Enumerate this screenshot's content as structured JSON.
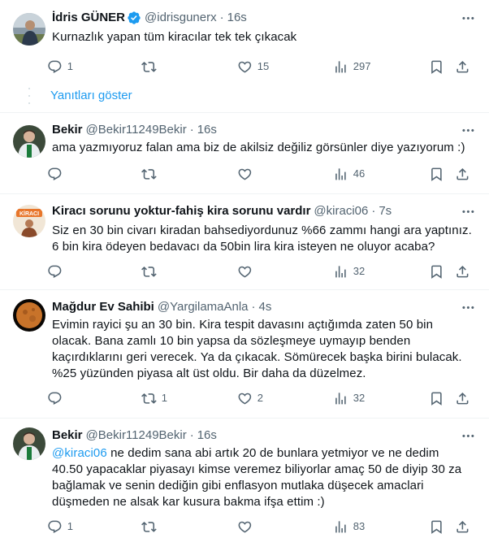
{
  "tweets": [
    {
      "name": "İdris GÜNER",
      "verified": true,
      "handle": "@idrisgunerx",
      "time": "16s",
      "text": "Kurnazlık yapan tüm kiracılar tek tek çıkacak",
      "reply_count": "1",
      "retweet_count": "",
      "like_count": "15",
      "view_count": "297",
      "avatar_desc": "man-outdoors-avatar"
    },
    {
      "name": "Bekir",
      "handle": "@Bekir11249Bekir",
      "time": "16s",
      "text": "ama yazmıyoruz falan ama biz de akilsiz değiliz görsünler diye yazıyorum :)",
      "reply_count": "",
      "retweet_count": "",
      "like_count": "",
      "view_count": "46",
      "avatar_desc": "football-player-avatar"
    },
    {
      "name": "Kiracı sorunu yoktur-fahiş kira sorunu vardır",
      "handle": "@kiraci06",
      "time": "7s",
      "text_lines": [
        "Siz en 30 bin civarı kiradan bahsediyordunuz %66 zammı hangi ara yaptınız.",
        "6 bin kira ödeyen bedavacı da 50bin lira kira isteyen ne oluyor acaba?"
      ],
      "reply_count": "",
      "retweet_count": "",
      "like_count": "",
      "view_count": "32",
      "avatar_desc": "kiraci-logo-avatar"
    },
    {
      "name": "Mağdur Ev Sahibi",
      "handle": "@YargilamaAnla",
      "time": "4s",
      "text_lines": [
        "Evimin rayici şu an 30 bin. Kira tespit davasını açtığımda zaten 50 bin",
        "olacak. Bana zamlı 10 bin yapsa da sözleşmeye uymayıp benden",
        "kaçırdıklarını geri verecek. Ya da çıkacak. Sömürecek başka birini bulacak.",
        "%25 yüzünden piyasa alt üst oldu. Bir daha da düzelmez."
      ],
      "reply_count": "",
      "retweet_count": "1",
      "like_count": "2",
      "view_count": "32",
      "avatar_desc": "moon-avatar"
    },
    {
      "name": "Bekir",
      "handle": "@Bekir11249Bekir",
      "time": "16s",
      "mention": "@kiraci06",
      "text_first_rest": " ne dedim sana abi artık 20 de bunlara yetmiyor ve ne dedim",
      "text_lines": [
        "40.50 yapacaklar piyasayı kimse veremez biliyorlar amaç 50 de diyip 30 za",
        "bağlamak ve senin dediğin gibi enflasyon mutlaka düşecek amaclari",
        "düşmeden ne alsak kar kusura bakma ifşa ettim :)"
      ],
      "reply_count": "1",
      "retweet_count": "",
      "like_count": "",
      "view_count": "83",
      "avatar_desc": "football-player-avatar"
    }
  ],
  "show_replies_label": "Yanıtları göster",
  "colors": {
    "accent": "#1d9bf0",
    "text": "#0f1419",
    "secondary": "#536471",
    "divider": "#eff3f4"
  }
}
